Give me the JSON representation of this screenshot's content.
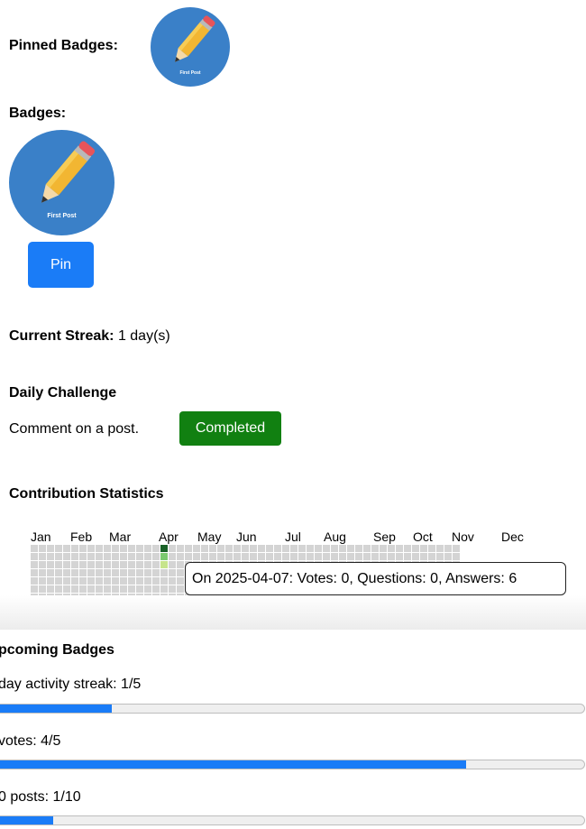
{
  "pinned": {
    "label": "Pinned Badges:",
    "badge_caption": "First Post"
  },
  "badges": {
    "label": "Badges:",
    "badge_caption": "First Post",
    "pin_button": "Pin"
  },
  "streak": {
    "label": "Current Streak:",
    "value": "1 day(s)"
  },
  "challenge": {
    "title": "Daily Challenge",
    "task": "Comment on a post.",
    "status_button": "Completed"
  },
  "contributions": {
    "title": "Contribution Statistics",
    "months": [
      "Jan",
      "Feb",
      "Mar",
      "Apr",
      "May",
      "Jun",
      "Jul",
      "Aug",
      "Sep",
      "Oct",
      "Nov",
      "Dec"
    ],
    "tooltip": "On 2025-04-07: Votes: 0, Questions: 0, Answers: 6",
    "colors": {
      "empty": "#d4d4d4",
      "level1": "#c6e48b",
      "level2": "#7bc96f",
      "level4": "#196127"
    }
  },
  "upcoming": {
    "title": "pcoming Badges",
    "items": [
      {
        "label": "day activity streak: 1/5",
        "progress": 0.2
      },
      {
        "label": "votes: 4/5",
        "progress": 0.8
      },
      {
        "label": "0 posts: 1/10",
        "progress": 0.1
      }
    ]
  }
}
